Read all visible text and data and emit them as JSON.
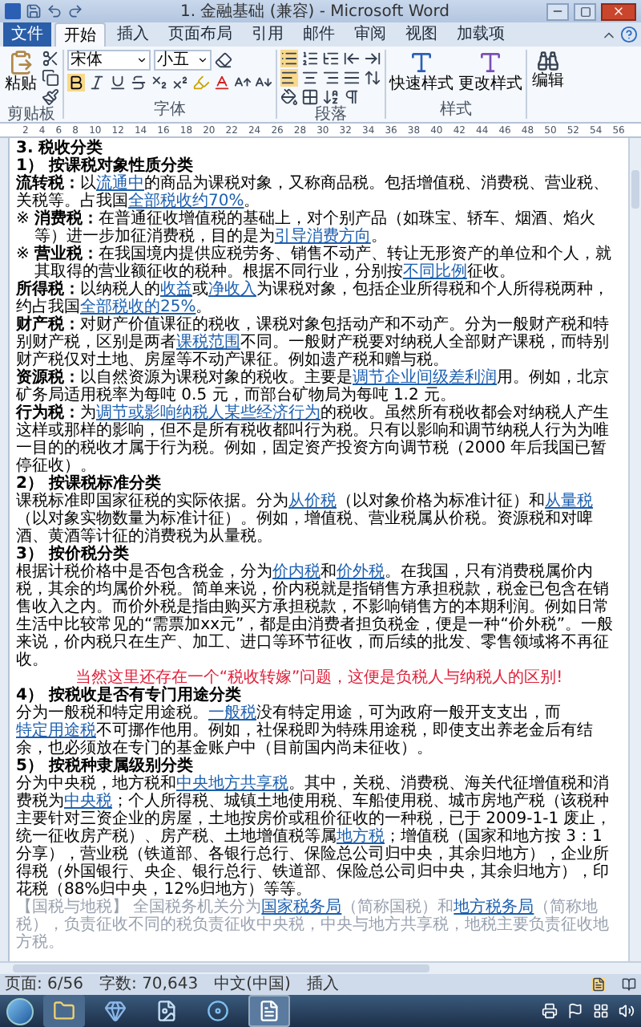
{
  "window": {
    "title": "1. 金融基础 (兼容) - Microsoft Word"
  },
  "tabs": [
    {
      "label": "文件",
      "selected": false,
      "kind": "file"
    },
    {
      "label": "开始",
      "selected": true,
      "kind": "tab"
    },
    {
      "label": "插入",
      "selected": false,
      "kind": "tab"
    },
    {
      "label": "页面布局",
      "selected": false,
      "kind": "tab"
    },
    {
      "label": "引用",
      "selected": false,
      "kind": "tab"
    },
    {
      "label": "邮件",
      "selected": false,
      "kind": "tab"
    },
    {
      "label": "审阅",
      "selected": false,
      "kind": "tab"
    },
    {
      "label": "视图",
      "selected": false,
      "kind": "tab"
    },
    {
      "label": "加载项",
      "selected": false,
      "kind": "tab"
    }
  ],
  "ribbon": {
    "clipboard": {
      "paste": "粘贴",
      "group_label": "剪贴板"
    },
    "font": {
      "font_name": "宋体",
      "font_size": "小五",
      "group_label": "字体"
    },
    "paragraph": {
      "group_label": "段落"
    },
    "styles": {
      "quick_styles": "快速样式",
      "change_styles": "更改样式",
      "group_label": "样式"
    },
    "editing": {
      "label": "编辑"
    }
  },
  "ruler_marks": [
    "2",
    "4",
    "6",
    "8",
    "10",
    "12",
    "14",
    "16",
    "18",
    "20",
    "22",
    "24",
    "26",
    "28",
    "30",
    "32",
    "34",
    "36",
    "38",
    "40",
    "42",
    "44",
    "46",
    "48",
    "50",
    "52",
    "54",
    "56"
  ],
  "document": {
    "blocks": [
      {
        "kind": "heading",
        "segments": [
          {
            "text": "3.  税收分类",
            "kind": "plain"
          }
        ]
      },
      {
        "kind": "subheading",
        "segments": [
          {
            "text": "1）  按课税对象性质分类",
            "kind": "plain"
          }
        ]
      },
      {
        "kind": "paragraph",
        "segments": [
          {
            "text": "流转税：",
            "kind": "term"
          },
          {
            "text": "以",
            "kind": "plain"
          },
          {
            "text": "流通中",
            "kind": "link"
          },
          {
            "text": "的商品为课税对象，又称商品税。包括增值税、消费税、营业税、关税等。占我国",
            "kind": "plain"
          },
          {
            "text": "全部税收约70%",
            "kind": "link"
          },
          {
            "text": "。",
            "kind": "plain"
          }
        ]
      },
      {
        "kind": "bullet",
        "mark": "※",
        "segments": [
          {
            "text": "消费税：",
            "kind": "term"
          },
          {
            "text": "在普通征收增值税的基础上，对个别产品（如珠宝、轿车、烟酒、焰火等）进一步加征消费税，目的是为",
            "kind": "plain"
          },
          {
            "text": "引导消费方向",
            "kind": "link"
          },
          {
            "text": "。",
            "kind": "plain"
          }
        ]
      },
      {
        "kind": "bullet",
        "mark": "※",
        "segments": [
          {
            "text": "营业税：",
            "kind": "term"
          },
          {
            "text": "在我国境内提供应税劳务、销售不动产、转让无形资产的单位和个人，就其取得的营业额征收的税种。根据不同行业，分别按",
            "kind": "plain"
          },
          {
            "text": "不同比例",
            "kind": "link"
          },
          {
            "text": "征收。",
            "kind": "plain"
          }
        ]
      },
      {
        "kind": "paragraph",
        "segments": [
          {
            "text": "所得税：",
            "kind": "term"
          },
          {
            "text": "以纳税人的",
            "kind": "plain"
          },
          {
            "text": "收益",
            "kind": "link"
          },
          {
            "text": "或",
            "kind": "plain"
          },
          {
            "text": "净收入",
            "kind": "link"
          },
          {
            "text": "为课税对象，包括企业所得税和个人所得税两种，约占我国",
            "kind": "plain"
          },
          {
            "text": "全部税收的25%",
            "kind": "link"
          },
          {
            "text": "。",
            "kind": "plain"
          }
        ]
      },
      {
        "kind": "paragraph",
        "segments": [
          {
            "text": "财产税：",
            "kind": "term"
          },
          {
            "text": "对财产价值课征的税收，课税对象包括动产和不动产。分为一般财产税和特别财产税，区别是两者",
            "kind": "plain"
          },
          {
            "text": "课税范围",
            "kind": "link"
          },
          {
            "text": "不同。一般财产税要对纳税人全部财产课税，而特别财产税仅对土地、房屋等不动产课征。例如遗产税和赠与税。",
            "kind": "plain"
          }
        ]
      },
      {
        "kind": "paragraph",
        "segments": [
          {
            "text": "资源税：",
            "kind": "term"
          },
          {
            "text": "以自然资源为课税对象的税收。主要是",
            "kind": "plain"
          },
          {
            "text": "调节企业间级差利润",
            "kind": "link"
          },
          {
            "text": "用。例如，北京矿务局适用税率为每吨 0.5 元，而部台矿物局为每吨 1.2 元。",
            "kind": "plain"
          }
        ]
      },
      {
        "kind": "paragraph",
        "segments": [
          {
            "text": "行为税：",
            "kind": "term"
          },
          {
            "text": "为",
            "kind": "plain"
          },
          {
            "text": "调节或影响纳税人某些经济行为",
            "kind": "link"
          },
          {
            "text": "的税收。虽然所有税收都会对纳税人产生这样或那样的影响，但不是所有税收都叫行为税。只有以影响和调节纳税人行为为唯一目的的税收才属于行为税。例如，固定资产投资方向调节税（2000 年后我国已暂停征收）。",
            "kind": "plain"
          }
        ]
      },
      {
        "kind": "subheading",
        "segments": [
          {
            "text": "2）  按课税标准分类",
            "kind": "plain"
          }
        ]
      },
      {
        "kind": "paragraph",
        "segments": [
          {
            "text": "课税标准即国家征税的实际依据。分为",
            "kind": "plain"
          },
          {
            "text": "从价税",
            "kind": "link"
          },
          {
            "text": "（以对象价格为标准计征）和",
            "kind": "plain"
          },
          {
            "text": "从量税",
            "kind": "link"
          },
          {
            "text": "（以对象实物数量为标准计征）。例如，增值税、营业税属从价税。资源税和对啤酒、黄酒等计征的消费税为从量税。",
            "kind": "plain"
          }
        ]
      },
      {
        "kind": "subheading",
        "segments": [
          {
            "text": "3）  按价税分类",
            "kind": "plain"
          }
        ]
      },
      {
        "kind": "paragraph",
        "segments": [
          {
            "text": "根据计税价格中是否包含税金，分为",
            "kind": "plain"
          },
          {
            "text": "价内税",
            "kind": "link"
          },
          {
            "text": "和",
            "kind": "plain"
          },
          {
            "text": "价外税",
            "kind": "link"
          },
          {
            "text": "。在我国，只有消费税属价内税，其余的均属价外税。简单来说，价内税就是指销售方承担税款，税金已包含在销售收入之内。而价外税是指由购买方承担税款，不影响销售方的本期利润。例如日常生活中比较常见的“需票加xx元”，都是由消费者担负税金，便是一种“价外税”。一般来说，价内税只在生产、加工、进口等环节征收，而后续的批发、零售领域将不再征收。",
            "kind": "plain"
          }
        ]
      },
      {
        "kind": "alert",
        "segments": [
          {
            "text": "当然这里还存在一个“税收转嫁”问题，这便是负税人与纳税人的区别!",
            "kind": "plain"
          }
        ]
      },
      {
        "kind": "subheading",
        "segments": [
          {
            "text": "4）  按税收是否有专门用途分类",
            "kind": "plain"
          }
        ]
      },
      {
        "kind": "paragraph",
        "segments": [
          {
            "text": "分为一般税和特定用途税。",
            "kind": "plain"
          },
          {
            "text": "一般税",
            "kind": "link"
          },
          {
            "text": "没有特定用途，可为政府一般开支支出，而",
            "kind": "plain"
          },
          {
            "text": "特定用途税",
            "kind": "link"
          },
          {
            "text": "不可挪作他用。例如，社保税即为特殊用途税，即使支出养老金后有结余，也必须放在专门的基金账户中（目前国内尚未征收）。",
            "kind": "plain"
          }
        ]
      },
      {
        "kind": "subheading",
        "segments": [
          {
            "text": "5）  按税种隶属级别分类",
            "kind": "plain"
          }
        ]
      },
      {
        "kind": "paragraph",
        "segments": [
          {
            "text": "分为中央税，地方税和",
            "kind": "plain"
          },
          {
            "text": "中央地方共享税",
            "kind": "link"
          },
          {
            "text": "。其中，关税、消费税、海关代征增值税和消费税为",
            "kind": "plain"
          },
          {
            "text": "中央税",
            "kind": "link"
          },
          {
            "text": "；个人所得税、城镇土地使用税、车船使用税、城市房地产税（该税种主要针对三资企业的房屋，土地按房价或租价征收的一种税，已于 2009-1-1 废止，统一征收房产税）、房产税、土地增值税等属",
            "kind": "plain"
          },
          {
            "text": "地方税",
            "kind": "link"
          },
          {
            "text": "；增值税（国家和地方按 3：1 分享），营业税（铁道部、各银行总行、保险总公司归中央，其余归地方），企业所得税（外国银行、央企、银行总行、铁道部、保险总公司归中央，其余归地方），印花税（88%归中央，12%归地方）等等。",
            "kind": "plain"
          }
        ]
      },
      {
        "kind": "note",
        "segments": [
          {
            "text": "【国税与地税】  全国税务机关分为",
            "kind": "plain"
          },
          {
            "text": "国家税务局",
            "kind": "link"
          },
          {
            "text": "（简称国税）和",
            "kind": "plain"
          },
          {
            "text": "地方税务局",
            "kind": "link"
          },
          {
            "text": "（简称地税），负责征收不同的税负责征收中央税，中央与地方共享税，地税主要负责征收地方税。",
            "kind": "plain"
          }
        ]
      }
    ]
  },
  "status_bar": {
    "page": "页面: 6/56",
    "words": "字数: 70,643",
    "language": "中文(中国)",
    "mode": "插入"
  }
}
